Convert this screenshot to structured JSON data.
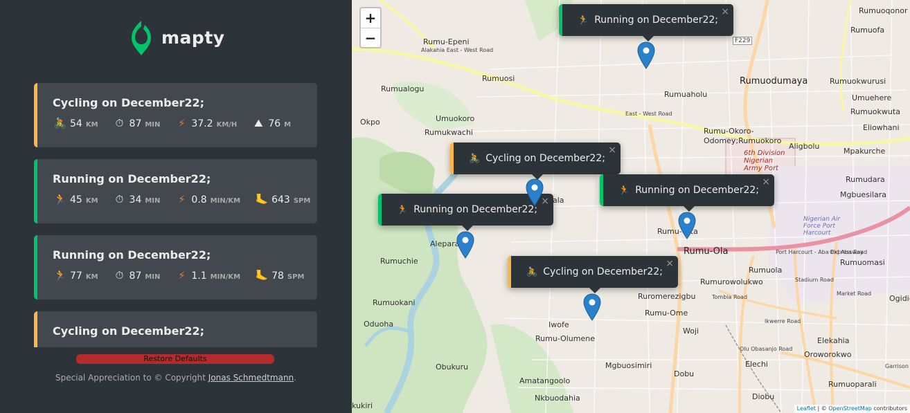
{
  "app": {
    "name": "mapty"
  },
  "workouts": [
    {
      "type": "cycling",
      "title": "Cycling on December22;",
      "details": [
        {
          "icon": "cycling-icon",
          "glyph": "🚴",
          "value": "54",
          "unit": "KM"
        },
        {
          "icon": "stopwatch-icon",
          "glyph": "⏱",
          "value": "87",
          "unit": "MIN"
        },
        {
          "icon": "lightning-icon",
          "glyph": "⚡",
          "value": "37.2",
          "unit": "KM/H"
        },
        {
          "icon": "mountain-icon",
          "glyph": "⛰",
          "value": "76",
          "unit": "M"
        }
      ]
    },
    {
      "type": "running",
      "title": "Running on December22;",
      "details": [
        {
          "icon": "running-icon",
          "glyph": "🏃",
          "value": "45",
          "unit": "KM"
        },
        {
          "icon": "stopwatch-icon",
          "glyph": "⏱",
          "value": "34",
          "unit": "MIN"
        },
        {
          "icon": "lightning-icon",
          "glyph": "⚡",
          "value": "0.8",
          "unit": "MIN/KM"
        },
        {
          "icon": "footprint-icon",
          "glyph": "🦶",
          "value": "643",
          "unit": "SPM"
        }
      ]
    },
    {
      "type": "running",
      "title": "Running on December22;",
      "details": [
        {
          "icon": "running-icon",
          "glyph": "🏃",
          "value": "77",
          "unit": "KM"
        },
        {
          "icon": "stopwatch-icon",
          "glyph": "⏱",
          "value": "87",
          "unit": "MIN"
        },
        {
          "icon": "lightning-icon",
          "glyph": "⚡",
          "value": "1.1",
          "unit": "MIN/KM"
        },
        {
          "icon": "footprint-icon",
          "glyph": "🦶",
          "value": "78",
          "unit": "SPM"
        }
      ]
    },
    {
      "type": "cycling",
      "title": "Cycling on December22;",
      "details": []
    }
  ],
  "restore_label": "Restore Defaults",
  "footer": {
    "text": "Special Appreciation to © Copyright ",
    "link": "Jonas Schmedtmann",
    "end": "."
  },
  "map": {
    "zoom_in": "+",
    "zoom_out": "−",
    "popups": [
      {
        "type": "running",
        "glyph": "🏃",
        "label": "Running on December22;"
      },
      {
        "type": "cycling",
        "glyph": "🚴",
        "label": "Cycling on December22;"
      },
      {
        "type": "running",
        "glyph": "🏃",
        "label": "Running on December22;"
      },
      {
        "type": "running",
        "glyph": "🏃",
        "label": "Running on December22;"
      },
      {
        "type": "cycling",
        "glyph": "🚴",
        "label": "Cycling on December22;"
      }
    ],
    "close_glyph": "×",
    "labels": [
      "Rumu-Epeni",
      "Alakahia East - West Road",
      "Rumuosi",
      "Rumualogu",
      "Umuokoro",
      "Okpo",
      "Rumukwachi",
      "Rumuaholu",
      "Rumuodumaya",
      "Rumuoqonor",
      "Rumuofa",
      "Rumuokwurusi",
      "Umuehere",
      "Rumuokwuta",
      "Eliowhani",
      "East - West Road",
      "Rumu-Okoro-Odomey;Rumuokoro",
      "Aligbolu",
      "Mpakurche",
      "Rumudara",
      "Mgbuesilara",
      "Rumu-Olta",
      "Rumu-Ola",
      "Rumuola",
      "Rumuomasi",
      "Rumuchie",
      "Aleparanta",
      "Rumurowolukwo",
      "Ruromerezigbu",
      "Rumuokani",
      "Oduoha",
      "Rumu-Ome",
      "Iwofe",
      "Rumu-Olumene",
      "Woji",
      "Elekahia",
      "Oroworokwo",
      "Obukuru",
      "Elechi",
      "Rumuoparali",
      "Amatangoolo",
      "Mgbuosimiri",
      "Dobu",
      "Nkbuodahia",
      "Diobu",
      "Ogidig",
      "kukiri",
      "Port Harcourt - Aba Expressway",
      "Old Aba Road",
      "Ikwerre Road",
      "Stadium Road",
      "Market Road",
      "Garrison Road",
      "Olu Obasanjo Road",
      "Tombia Road",
      "F229",
      "ala"
    ],
    "army_label": "6th Division Nigerian Army Port",
    "airforce_label": "Nigerian Air Force Port Harcourt",
    "attribution": {
      "leaflet": "Leaflet",
      "sep": " | © ",
      "osm": "OpenStreetMap",
      "rest": " contributors"
    },
    "colors": {
      "running": "#00c46a",
      "cycling": "#ffb545",
      "marker": "#2a81cb",
      "sidebar": "#2d3439",
      "card": "#42484d"
    }
  }
}
